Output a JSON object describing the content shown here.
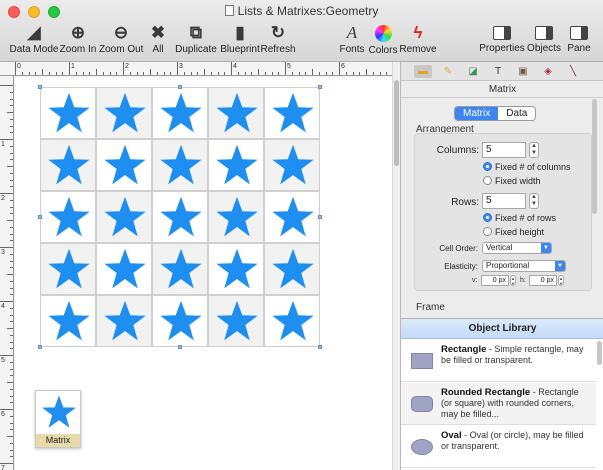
{
  "window": {
    "title": "Lists & Matrixes:Geometry"
  },
  "toolbar": {
    "items": [
      {
        "label": "Data Mode",
        "icon": "data-mode-icon",
        "glyph": "◢"
      },
      {
        "label": "Zoom In",
        "icon": "zoom-in-icon",
        "glyph": "⊕"
      },
      {
        "label": "Zoom Out",
        "icon": "zoom-out-icon",
        "glyph": "⊖"
      },
      {
        "label": "All",
        "icon": "expand-all-icon",
        "glyph": "✖"
      },
      {
        "label": "Duplicate",
        "icon": "duplicate-icon",
        "glyph": "⧉"
      },
      {
        "label": "Blueprint",
        "icon": "blueprint-icon",
        "glyph": "▮"
      },
      {
        "label": "Refresh",
        "icon": "refresh-icon",
        "glyph": "↻"
      },
      {
        "label": "Fonts",
        "icon": "fonts-icon",
        "glyph": "A"
      },
      {
        "label": "Colors",
        "icon": "colors-icon",
        "glyph": ""
      },
      {
        "label": "Remove",
        "icon": "remove-icon",
        "glyph": "ϟ"
      },
      {
        "label": "Properties",
        "icon": "properties-pane-icon",
        "glyph": ""
      },
      {
        "label": "Objects",
        "icon": "objects-pane-icon",
        "glyph": ""
      },
      {
        "label": "Pane",
        "icon": "pane-icon",
        "glyph": ""
      }
    ]
  },
  "ruler": {
    "top_marks": [
      "0",
      "1",
      "2",
      "3",
      "4",
      "5",
      "6"
    ],
    "left_marks": [
      "1",
      "2",
      "3",
      "4",
      "5",
      "6",
      "7"
    ]
  },
  "canvas": {
    "matrix": {
      "rows": 5,
      "columns": 5,
      "star_color": "#1e8ff0"
    },
    "thumbnail": {
      "label": "Matrix"
    }
  },
  "panel": {
    "tabs": [
      "ruler-tab",
      "pencil-tab",
      "shapes-tab",
      "text-tab",
      "image-tab",
      "bucket-tab",
      "line-tab"
    ],
    "tab_glyphs": [
      "▬",
      "✎",
      "◪",
      "T",
      "▣",
      "◈",
      "╲"
    ],
    "title": "Matrix",
    "mode_tabs": {
      "matrix": "Matrix",
      "data": "Data"
    },
    "arrangement": {
      "label": "Arrangement",
      "columns_label": "Columns:",
      "columns_value": "5",
      "fixed_columns": "Fixed # of columns",
      "fixed_width": "Fixed width",
      "rows_label": "Rows:",
      "rows_value": "5",
      "fixed_rows": "Fixed # of rows",
      "fixed_height": "Fixed height",
      "cell_order_label": "Cell Order:",
      "cell_order_value": "Vertical",
      "elasticity_label": "Elasticity:",
      "elasticity_value": "Proportional",
      "v_label": "v:",
      "v_value": "0 px",
      "h_label": "h:",
      "h_value": "0 px"
    },
    "frame_label": "Frame"
  },
  "library": {
    "title": "Object Library",
    "items": [
      {
        "name": "Rectangle",
        "desc": " - Simple rectangle, may be filled or transparent."
      },
      {
        "name": "Rounded Rectangle",
        "desc": " - Rectangle (or square) with rounded corners, may be filled..."
      },
      {
        "name": "Oval",
        "desc": " - Oval (or circle), may be filled or transparent."
      }
    ]
  },
  "colors": {
    "accent": "#3d86f0",
    "star": "#1e8ff0"
  }
}
